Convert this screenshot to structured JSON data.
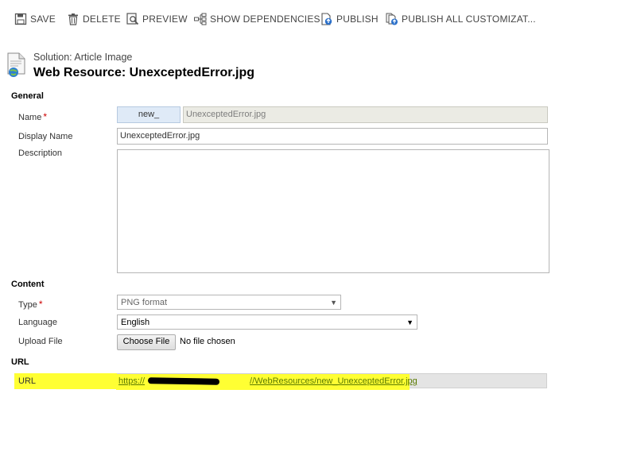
{
  "toolbar": {
    "save": "SAVE",
    "delete": "DELETE",
    "preview": "PREVIEW",
    "show_dependencies": "SHOW DEPENDENCIES",
    "publish": "PUBLISH",
    "publish_all": "PUBLISH ALL CUSTOMIZAT..."
  },
  "header": {
    "breadcrumb": "Solution: Article Image",
    "title": "Web Resource: UnexceptedError.jpg"
  },
  "general": {
    "section_label": "General",
    "name_label": "Name",
    "name_prefix": "new_",
    "name_value": "UnexceptedError.jpg",
    "display_name_label": "Display Name",
    "display_name_value": "UnexceptedError.jpg",
    "description_label": "Description",
    "description_value": ""
  },
  "content": {
    "section_label": "Content",
    "type_label": "Type",
    "type_value": "PNG format",
    "language_label": "Language",
    "language_value": "English",
    "upload_label": "Upload File",
    "choose_file_label": "Choose File",
    "no_file_text": "No file chosen"
  },
  "url": {
    "section_label": "URL",
    "field_label": "URL",
    "link_prefix": "https://",
    "link_suffix": "//WebResources/new_UnexceptedError.jpg"
  },
  "required_marker": "*",
  "colors": {
    "highlight": "#ffff33",
    "prefix_bg": "#dfeaf7",
    "required": "#cc0000",
    "link": "#5a7a00"
  }
}
